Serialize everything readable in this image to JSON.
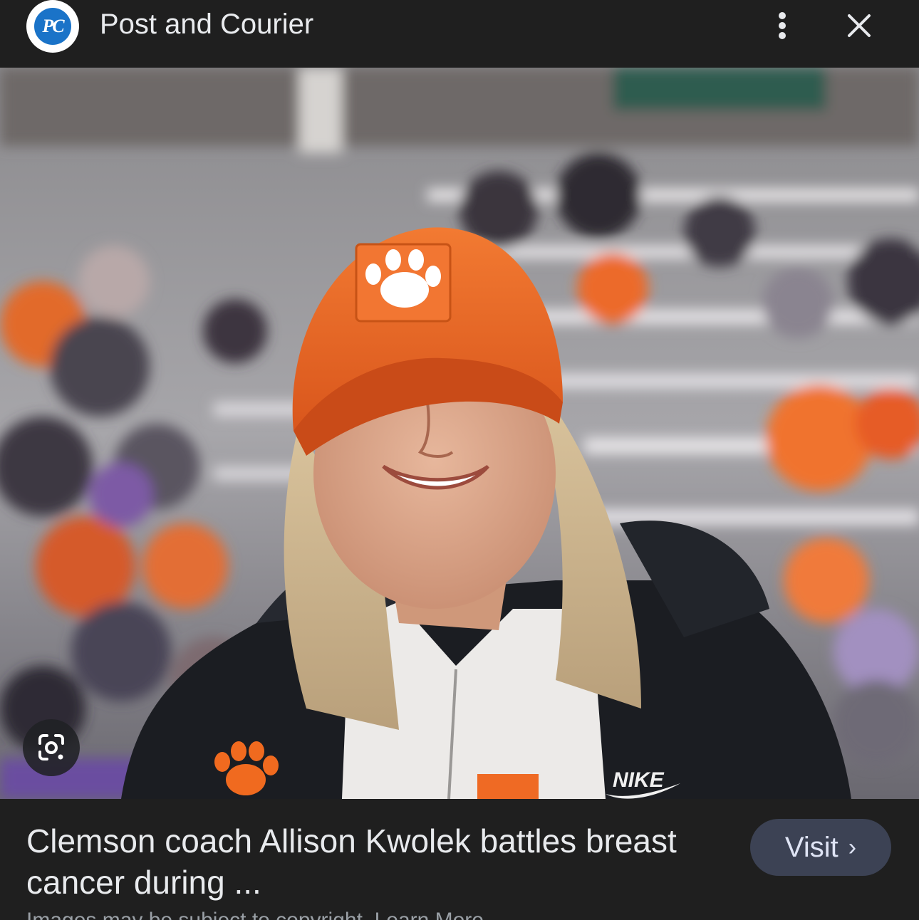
{
  "header": {
    "favicon_text": "PC",
    "source_title": "Post and Courier",
    "more_icon": "more-vert-icon",
    "close_icon": "close-icon"
  },
  "image": {
    "alt": "Smiling woman in orange Clemson cap and black Nike puffer jacket in front of stadium crowd",
    "lens_icon": "google-lens-icon"
  },
  "caption": {
    "title": "Clemson coach Allison Kwolek battles breast cancer during ...",
    "visit_label": "Visit",
    "visit_chevron": "›",
    "copyright_partial": "Images may be subject to copyright. Learn More"
  },
  "colors": {
    "background": "#1f1f1f",
    "visit_button": "#3c4254",
    "clemson_orange": "#f56600"
  }
}
